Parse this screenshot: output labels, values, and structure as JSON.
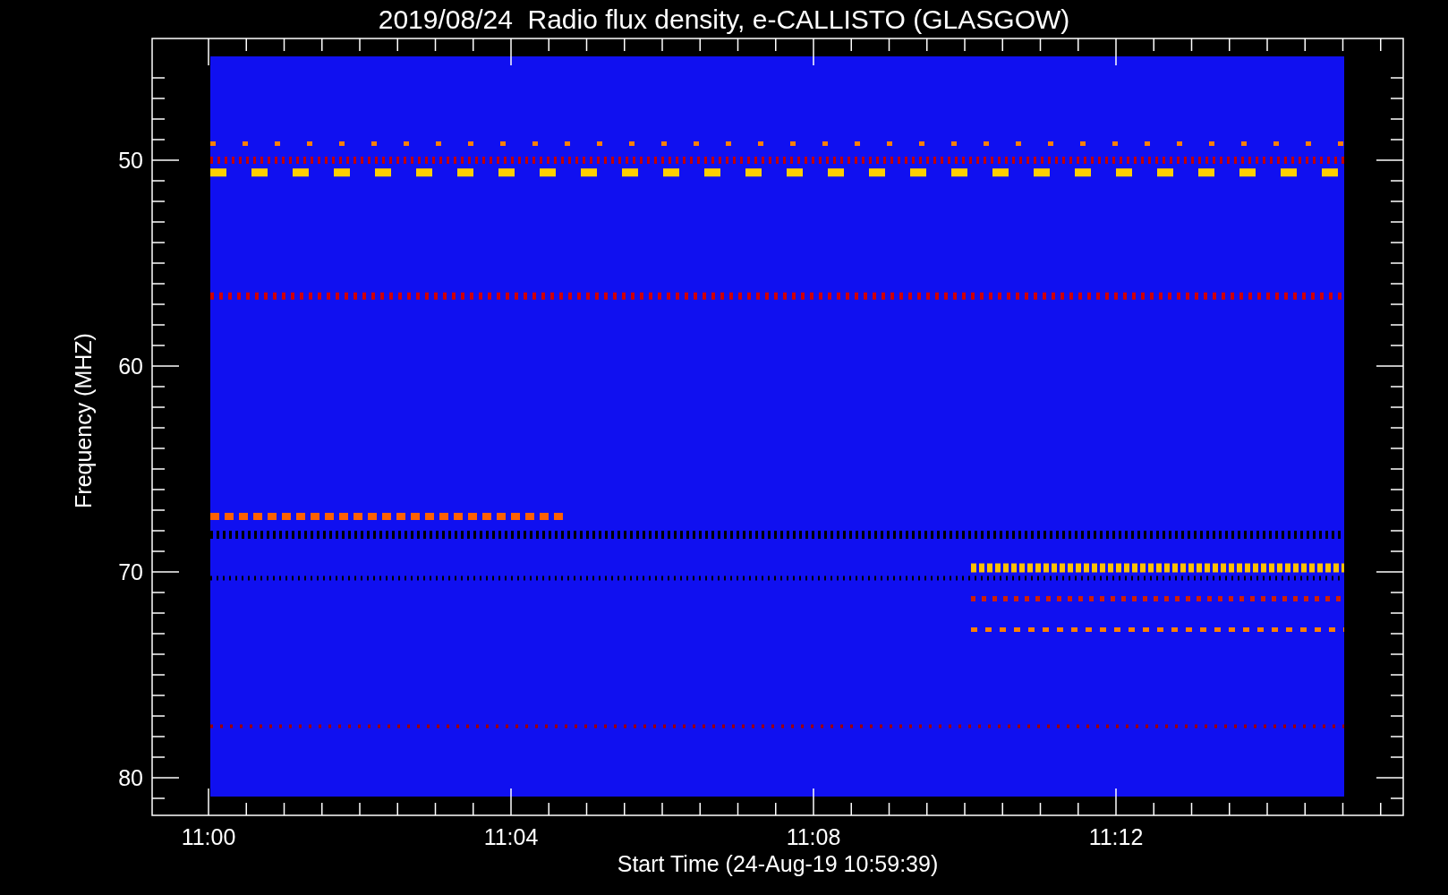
{
  "title": "2019/08/24  Radio flux density, e-CALLISTO (GLASGOW)",
  "y_axis": {
    "label": "Frequency (MHZ)",
    "ticks": [
      "50",
      "60",
      "70",
      "80"
    ]
  },
  "x_axis": {
    "label": "Start Time (24-Aug-19 10:59:39)",
    "ticks": [
      "11:00",
      "11:04",
      "11:08",
      "11:12"
    ]
  }
}
